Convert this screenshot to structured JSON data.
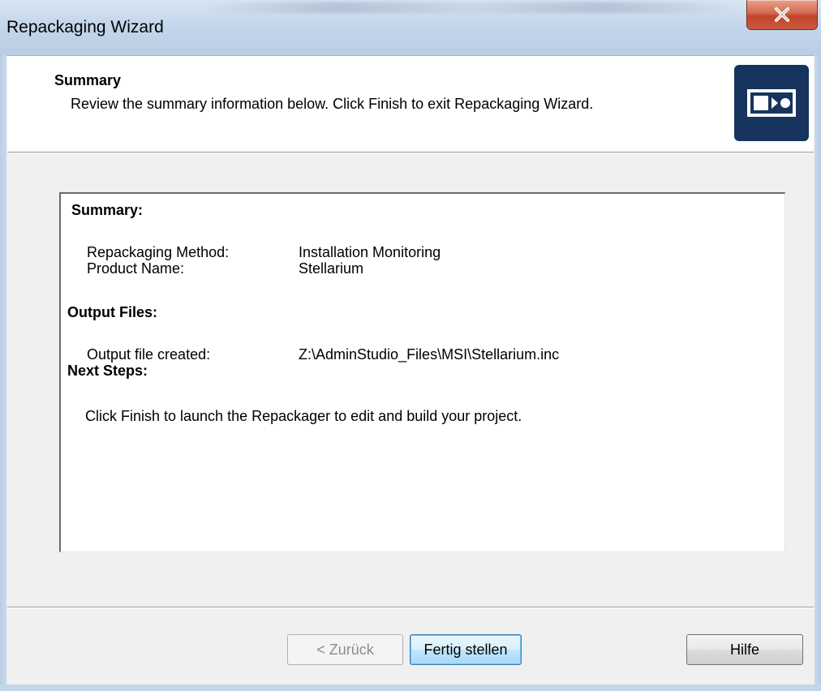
{
  "window": {
    "title": "Repackaging Wizard"
  },
  "header": {
    "title": "Summary",
    "description": "Review the summary information below. Click Finish to exit Repackaging Wizard."
  },
  "summary": {
    "heading": "Summary:",
    "method_label": "Repackaging Method:",
    "method_value": "Installation Monitoring",
    "product_label": "Product Name:",
    "product_value": "Stellarium",
    "output_heading": "Output Files:",
    "output_label": "Output file created:",
    "output_value": "Z:\\AdminStudio_Files\\MSI\\Stellarium.inc",
    "next_heading": "Next Steps:",
    "next_text": "Click Finish to launch the Repackager to edit and build your project."
  },
  "buttons": {
    "back": "< Zurück",
    "finish": "Fertig stellen",
    "help": "Hilfe"
  },
  "icons": {
    "close": "close-icon",
    "logo": "repackager-logo-icon"
  },
  "colors": {
    "logo_bg": "#17345f",
    "close_bg": "#c9442a"
  }
}
